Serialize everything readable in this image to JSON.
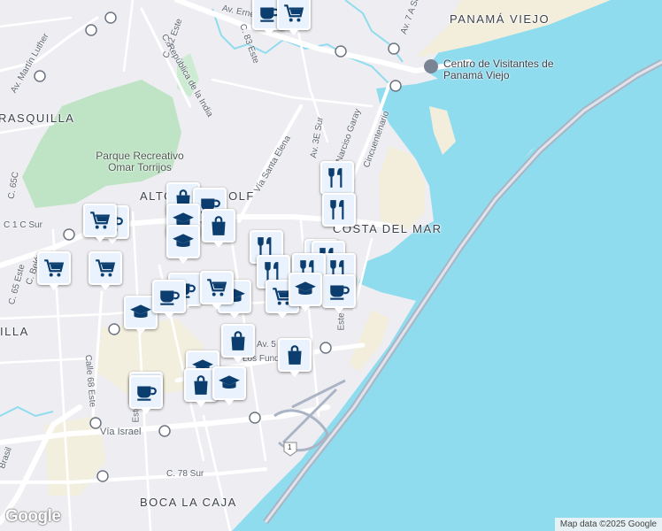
{
  "map": {
    "labels": {
      "areas": [
        "PANAMÁ VIEJO",
        "RASQUILLA",
        "ALTOS DEL GOLF",
        "COSTA DEL MAR",
        "ILLA",
        "BOCA LA CAJA"
      ],
      "park": "Parque Recreativo Omar Torrijos",
      "poi": "Centro de Visitantes de Panamá Viejo",
      "streets": [
        "Av. Ernesto T. Lefevre",
        "C. 82 Este",
        "C. 83 Este",
        "C. República de la India",
        "Av. Martín Luther",
        "Av. 7 A Sur",
        "Av. 3E Sur",
        "Narciso Garay",
        "Cincuentenario",
        "Vía Santa Elena",
        "C. 65C",
        "C 1 C Sur",
        "C. Belén",
        "C. 65 Este",
        "Calle 68 Este",
        "Vía Israel",
        "C. 78 Sur",
        "Av. 5",
        "Los Fundadores",
        "Brasil",
        "Este",
        "Este"
      ],
      "route_shield": "1"
    },
    "pins": [
      {
        "type": "cafe"
      },
      {
        "type": "shopping-cart"
      },
      {
        "type": "restaurant"
      },
      {
        "type": "restaurant"
      },
      {
        "type": "shopping-bag"
      },
      {
        "type": "cafe"
      },
      {
        "type": "school"
      },
      {
        "type": "shopping-bag"
      },
      {
        "type": "school"
      },
      {
        "type": "cafe"
      },
      {
        "type": "shopping-cart"
      },
      {
        "type": "shopping-cart"
      },
      {
        "type": "shopping-cart"
      },
      {
        "type": "restaurant"
      },
      {
        "type": "restaurant"
      },
      {
        "type": "restaurant"
      },
      {
        "type": "restaurant"
      },
      {
        "type": "restaurant"
      },
      {
        "type": "restaurant"
      },
      {
        "type": "cafe"
      },
      {
        "type": "shopping-cart"
      },
      {
        "type": "school"
      },
      {
        "type": "cafe"
      },
      {
        "type": "school"
      },
      {
        "type": "shopping-cart"
      },
      {
        "type": "school"
      },
      {
        "type": "cafe"
      },
      {
        "type": "shopping-bag"
      },
      {
        "type": "shopping-bag"
      },
      {
        "type": "school"
      },
      {
        "type": "cafe"
      },
      {
        "type": "shopping-bag"
      },
      {
        "type": "school"
      },
      {
        "type": "cafe"
      }
    ]
  },
  "branding": {
    "google": "Google",
    "attribution": "Map data ©2025 Google"
  },
  "colors": {
    "water": "#8fdcee",
    "land": "#eeeef2",
    "park": "#bfe3c5",
    "beach": "#f3eedc",
    "highway": "#aab4c4",
    "pin_icon": "#0b3d6e"
  }
}
